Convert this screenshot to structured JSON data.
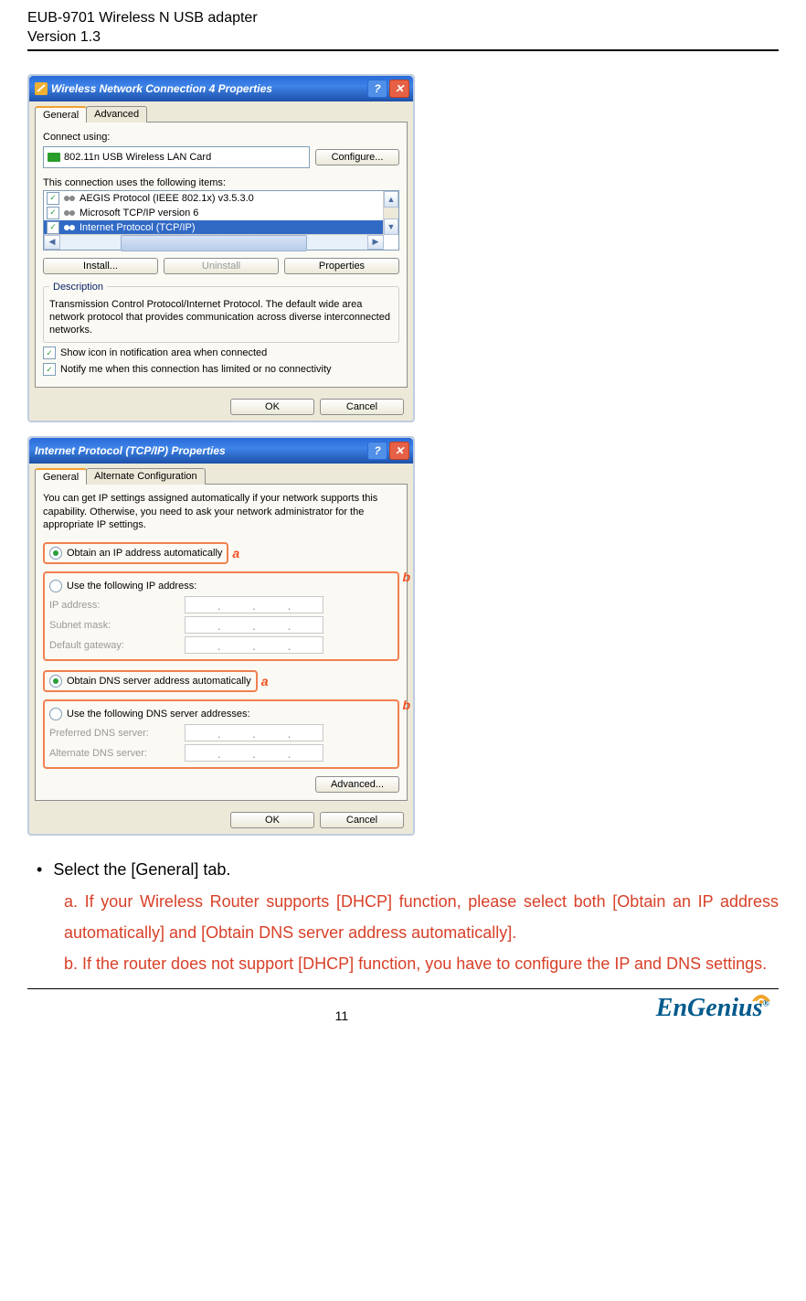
{
  "header": {
    "product": "EUB-9701 Wireless N USB adapter",
    "version": "Version 1.3"
  },
  "win1": {
    "title": "Wireless Network Connection 4 Properties",
    "tabs": [
      "General",
      "Advanced"
    ],
    "connect_using_lbl": "Connect using:",
    "adapter": "802.11n USB Wireless LAN Card",
    "configure_btn": "Configure...",
    "uses_lbl": "This connection uses the following items:",
    "items": [
      "AEGIS Protocol (IEEE 802.1x) v3.5.3.0",
      "Microsoft TCP/IP version 6",
      "Internet Protocol (TCP/IP)"
    ],
    "install_btn": "Install...",
    "uninstall_btn": "Uninstall",
    "properties_btn": "Properties",
    "desc_legend": "Description",
    "desc": "Transmission Control Protocol/Internet Protocol. The default wide area network protocol that provides communication across diverse interconnected networks.",
    "chk1": "Show icon in notification area when connected",
    "chk2": "Notify me when this connection has limited or no connectivity",
    "ok": "OK",
    "cancel": "Cancel"
  },
  "win2": {
    "title": "Internet Protocol (TCP/IP) Properties",
    "tabs": [
      "General",
      "Alternate Configuration"
    ],
    "intro": "You can get IP settings assigned automatically if your network supports this capability. Otherwise, you need to ask your network administrator for the appropriate IP settings.",
    "r1": "Obtain an IP address automatically",
    "r2": "Use the following IP address:",
    "ip_lbl": "IP address:",
    "mask_lbl": "Subnet mask:",
    "gw_lbl": "Default gateway:",
    "r3": "Obtain DNS server address automatically",
    "r4": "Use the following DNS server addresses:",
    "pdns_lbl": "Preferred DNS server:",
    "adns_lbl": "Alternate DNS server:",
    "adv_btn": "Advanced...",
    "ok": "OK",
    "cancel": "Cancel",
    "annot_a": "a",
    "annot_b": "b"
  },
  "body": {
    "bullet": "Select the [General] tab.",
    "a": "a. If your Wireless Router supports [DHCP] function, please select both [Obtain an IP address automatically] and [Obtain DNS server address automatically].",
    "b": "b. If the router does not support [DHCP] function, you have to configure the IP and DNS settings."
  },
  "footer": {
    "page": "11",
    "brand": "EnGenius"
  }
}
